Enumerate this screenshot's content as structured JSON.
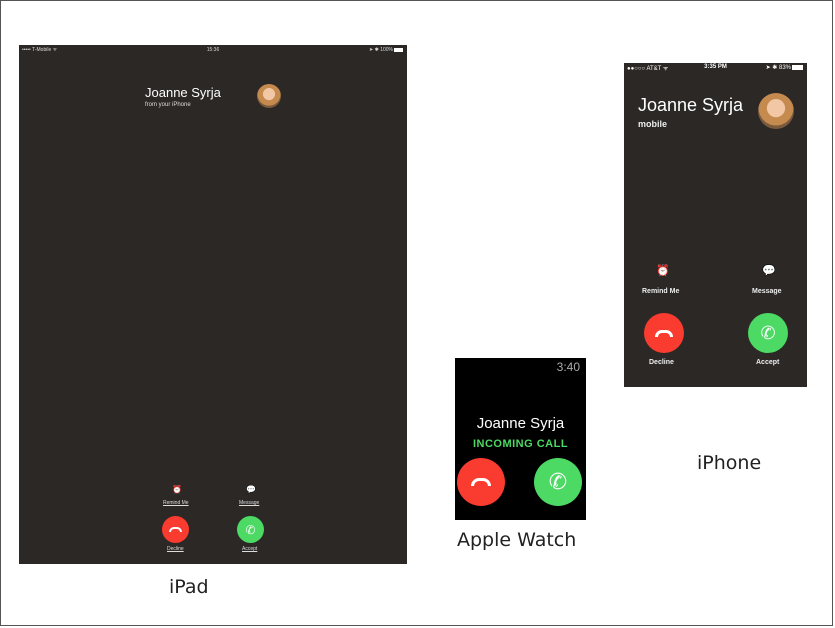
{
  "ipad": {
    "caption": "iPad",
    "status": {
      "carrier": "••••• T-Mobile ᯤ",
      "time": "15:36",
      "right": "➤ ✱ 100%"
    },
    "caller_name": "Joanne Syrja",
    "caller_sub": "from your iPhone",
    "remind_label": "Remind Me",
    "message_label": "Message",
    "decline_label": "Decline",
    "accept_label": "Accept"
  },
  "watch": {
    "caption": "Apple Watch",
    "time": "3:40",
    "caller_name": "Joanne Syrja",
    "status": "INCOMING CALL"
  },
  "iphone": {
    "caption": "iPhone",
    "status": {
      "carrier": "●●○○○ AT&T ᯤ",
      "time": "3:35 PM",
      "right": "➤ ✱ 83%"
    },
    "caller_name": "Joanne Syrja",
    "caller_sub": "mobile",
    "remind_label": "Remind Me",
    "message_label": "Message",
    "decline_label": "Decline",
    "accept_label": "Accept"
  },
  "icons": {
    "alarm": "⏰",
    "message": "💬",
    "hangup": "hangup-icon",
    "phone": "📞"
  },
  "colors": {
    "decline": "#fa3b30",
    "accept": "#4cd964",
    "screen": "#2b2826"
  }
}
